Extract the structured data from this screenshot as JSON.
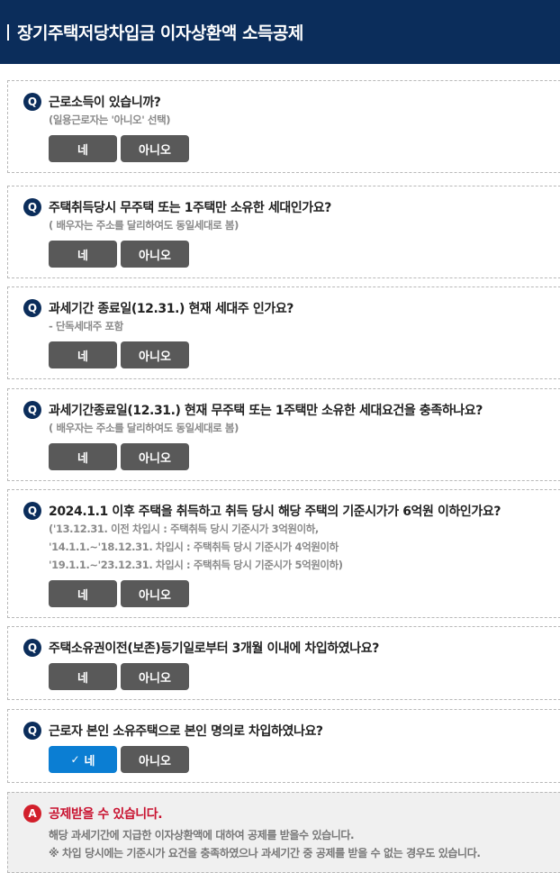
{
  "header": {
    "title": "장기주택저당차입금 이자상환액 소득공제"
  },
  "badges": {
    "question": "Q",
    "answer": "A"
  },
  "buttons": {
    "yes": "네",
    "no": "아니오"
  },
  "questions": [
    {
      "text": "근로소득이 있습니까?",
      "hints": [
        "(일용근로자는 '아니오' 선택)"
      ]
    },
    {
      "text": "주택취득당시 무주택 또는 1주택만 소유한 세대인가요?",
      "hints": [
        "( 배우자는 주소를 달리하여도 동일세대로 봄)"
      ]
    },
    {
      "text": "과세기간 종료일(12.31.) 현재 세대주 인가요?",
      "hints": [
        "- 단독세대주 포함"
      ]
    },
    {
      "text": "과세기간종료일(12.31.) 현재 무주택 또는 1주택만 소유한 세대요건을 충족하나요?",
      "hints": [
        "( 배우자는 주소를 달리하여도 동일세대로 봄)"
      ]
    },
    {
      "text": "2024.1.1 이후 주택을 취득하고 취득 당시 해당 주택의 기준시가가 6억원 이하인가요?",
      "hints": [
        "('13.12.31. 이전 차입시 : 주택취득 당시 기준시가 3억원이하,",
        "'14.1.1.~'18.12.31. 차입시 : 주택취득 당시 기준시가 4억원이하",
        "'19.1.1.~'23.12.31. 차입시 : 주택취득 당시 기준시가 5억원이하)"
      ]
    },
    {
      "text": "주택소유권이전(보존)등기일로부터 3개월 이내에 차입하였나요?",
      "hints": []
    },
    {
      "text": "근로자 본인 소유주택으로 본인 명의로 차입하였나요?",
      "hints": [],
      "selected": "yes"
    }
  ],
  "answer": {
    "title": "공제받을 수 있습니다.",
    "lines": [
      "해당 과세기간에 지급한 이자상환액에 대하여 공제를 받을수 있습니다.",
      "※ 차입 당시에는 기준시가 요건을 충족하였으나 과세기간 중 공제를 받을 수 없는 경우도 있습니다."
    ]
  }
}
